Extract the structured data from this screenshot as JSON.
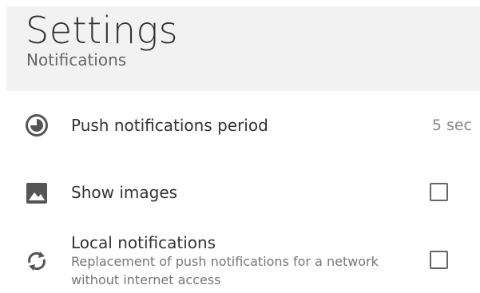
{
  "header": {
    "title": "Settings",
    "subtitle": "Notifications"
  },
  "settings": [
    {
      "label": "Push notifications period",
      "value": "5 sec",
      "icon": "timer-icon"
    },
    {
      "label": "Show images",
      "icon": "image-icon",
      "checked": false
    },
    {
      "label": "Local notifications",
      "description": "Replacement of push notifications for a network without internet access",
      "icon": "sync-icon",
      "checked": false
    }
  ],
  "colors": {
    "header_bg": "#f2f2f2",
    "text": "#333333",
    "secondary_text": "#777777",
    "icon": "#555555"
  }
}
